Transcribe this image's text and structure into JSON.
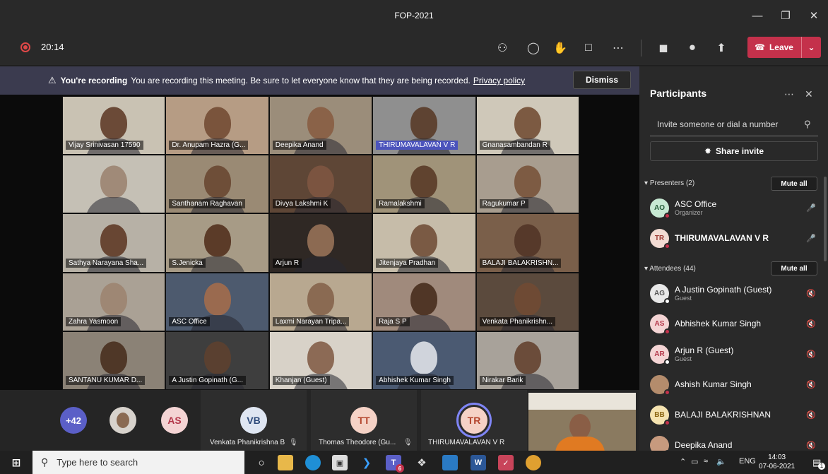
{
  "window": {
    "title": "FOP-2021",
    "controls": [
      "minimize",
      "restore",
      "close"
    ]
  },
  "toolbar": {
    "timer": "20:14",
    "icons": [
      "people-icon",
      "chat-icon",
      "reactions-icon",
      "rooms-icon",
      "more-icon",
      "camera-icon",
      "mic-icon",
      "share-icon"
    ],
    "leave_label": "Leave"
  },
  "banner": {
    "bold": "You're recording",
    "text": "You are recording this meeting. Be sure to let everyone know that they are being recorded.",
    "link": "Privacy policy",
    "dismiss": "Dismiss"
  },
  "tiles": [
    {
      "name": "Vijay Srinivasan 17590",
      "bg": "#c9c2b3",
      "face": "#6b4a37"
    },
    {
      "name": "Dr. Anupam Hazra (G...",
      "bg": "#b69c84",
      "face": "#7a543c"
    },
    {
      "name": "Deepika Anand",
      "bg": "#9b8d7a",
      "face": "#8a6248"
    },
    {
      "name": "THIRUMAVALAVAN V R",
      "bg": "#8f8f8f",
      "face": "#5e4332",
      "highlight": true
    },
    {
      "name": "Gnanasambandan R",
      "bg": "#cfc8b9",
      "face": "#7c5a42"
    },
    {
      "name": "",
      "bg": "#c5c0b5",
      "face": "#a08a78"
    },
    {
      "name": "Santhanam Raghavan",
      "bg": "#9a8a74",
      "face": "#6e4e38"
    },
    {
      "name": "Divya Lakshmi K",
      "bg": "#5e4636",
      "face": "#7b5440"
    },
    {
      "name": "Ramalakshmi",
      "bg": "#a09379",
      "face": "#60432f"
    },
    {
      "name": "Ragukumar P",
      "bg": "#a89d8f",
      "face": "#7d5b43"
    },
    {
      "name": "Sathya Narayana Sha...",
      "bg": "#b7b1a6",
      "face": "#684633"
    },
    {
      "name": "S.Jenicka",
      "bg": "#a79b86",
      "face": "#5b3b28"
    },
    {
      "name": "Arjun R",
      "bg": "#2f2824",
      "face": "#8c6a52"
    },
    {
      "name": "Jitenjaya Pradhan",
      "bg": "#c6bca9",
      "face": "#7a5a44"
    },
    {
      "name": "BALAJI BALAKRISHN...",
      "bg": "#7a5f4a",
      "face": "#56392a"
    },
    {
      "name": "Zahra Yasmoon",
      "bg": "#aaa195",
      "face": "#9e8774"
    },
    {
      "name": "ASC Office",
      "bg": "#4d5a6e",
      "face": "#9a6a4f"
    },
    {
      "name": "Laxmi Narayan Tripa...",
      "bg": "#b8a890",
      "face": "#8a6a52"
    },
    {
      "name": "Raja S P",
      "bg": "#a08a7c",
      "face": "#503626"
    },
    {
      "name": "Venkata Phanikrishn...",
      "bg": "#5b4a3d",
      "face": "#6e4a34"
    },
    {
      "name": "SANTANU KUMAR D...",
      "bg": "#8b8276",
      "face": "#4f3727"
    },
    {
      "name": "A Justin Gopinath (G...",
      "bg": "#3e3e3e",
      "face": "#5a4030"
    },
    {
      "name": "Khanjan (Guest)",
      "bg": "#d8d2c8",
      "face": "#8c6a55"
    },
    {
      "name": "Abhishek Kumar Singh",
      "bg": "#4b5a72",
      "face": "#d0d4dc"
    },
    {
      "name": "Nirakar Barik",
      "bg": "#a8a29a",
      "face": "#6b4c3a"
    }
  ],
  "strip": {
    "more_count": "+42",
    "as_initials": "AS",
    "vb_initials": "VB",
    "vb_name": "Venkata Phanikrishna B",
    "tt_initials": "TT",
    "tt_name": "Thomas Theodore (Gu...",
    "tr_initials": "TR",
    "tr_name": "THIRUMAVALAVAN V R"
  },
  "panel": {
    "title": "Participants",
    "invite_placeholder": "Invite someone or dial a number",
    "share_invite": "Share invite",
    "presenters_label": "Presenters (2)",
    "attendees_label": "Attendees (44)",
    "mute_all": "Mute all",
    "presenters": [
      {
        "initials": "AO",
        "name": "ASC Office",
        "sub": "Organizer",
        "color": "#c7e9d3",
        "text": "#245c38",
        "mic": "on",
        "status": "#c4314b"
      },
      {
        "initials": "TR",
        "name": "THIRUMAVALAVAN V R",
        "sub": "",
        "color": "#f2dbd3",
        "text": "#9d3b34",
        "mic": "on",
        "status": "#c4314b",
        "bold": true
      }
    ],
    "attendees": [
      {
        "initials": "AG",
        "name": "A Justin Gopinath (Guest)",
        "sub": "Guest",
        "color": "#e8e8e8",
        "text": "#555",
        "status": "#ffffff"
      },
      {
        "initials": "AS",
        "name": "Abhishek Kumar Singh",
        "sub": "",
        "color": "#f4d4d4",
        "text": "#b4374a",
        "status": "#c4314b"
      },
      {
        "initials": "AR",
        "name": "Arjun R (Guest)",
        "sub": "Guest",
        "color": "#f4d4d4",
        "text": "#b4374a",
        "status": "#ffffff"
      },
      {
        "initials": "",
        "name": "Ashish Kumar Singh",
        "sub": "",
        "color": "#b48c6c",
        "text": "#fff",
        "status": "#c4314b"
      },
      {
        "initials": "BB",
        "name": "BALAJI BALAKRISHNAN",
        "sub": "",
        "color": "#f5e3b0",
        "text": "#8a6410",
        "status": "#c4314b"
      },
      {
        "initials": "",
        "name": "Deepika Anand",
        "sub": "",
        "color": "#c79a7e",
        "text": "#fff",
        "status": "#c4314b"
      }
    ]
  },
  "taskbar": {
    "search_placeholder": "Type here to search",
    "lang": "ENG",
    "time": "14:03",
    "date": "07-06-2021",
    "teams_badge": "6",
    "notif_count": "1"
  }
}
